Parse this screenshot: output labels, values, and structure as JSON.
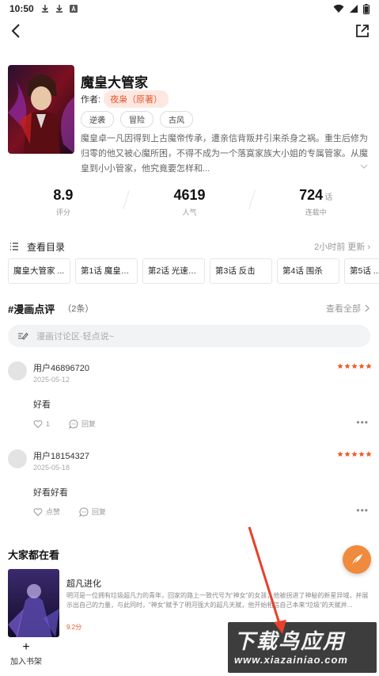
{
  "status_bar": {
    "time": "10:50"
  },
  "book": {
    "title": "魔皇大管家",
    "author_label": "作者:",
    "author": "夜枭（原著）",
    "tags": [
      "逆袭",
      "冒险",
      "古风"
    ],
    "description": "魔皇卓一凡因得到上古魔帝传承，遭亲信背叛并引来杀身之祸。重生后修为归零的他又被心魔所困，不得不成为一个落寞家族大小姐的专属管家。从魔皇到小小管家，他究竟要怎样和..."
  },
  "stats": [
    {
      "value": "8.9",
      "unit": "",
      "label": "评分"
    },
    {
      "value": "4619",
      "unit": "",
      "label": "人气"
    },
    {
      "value": "724",
      "unit": "话",
      "label": "连载中"
    }
  ],
  "toc": {
    "label": "查看目录",
    "update": "2小时前 更新",
    "chapters": [
      "魔皇大管家 ...",
      "第1话 魔皇的...",
      "第2话 光速突...",
      "第3话 反击",
      "第4话 围杀",
      "第5话 ..."
    ]
  },
  "comments": {
    "title": "#漫画点评",
    "count": "（2条）",
    "view_all": "查看全部",
    "input_placeholder": "漫画讨论区·轻点说~",
    "items": [
      {
        "user": "用户46896720",
        "date": "2025-05-12",
        "body": "好看",
        "likes": "1",
        "reply": "回复"
      },
      {
        "user": "用户18154327",
        "date": "2025-05-18",
        "body": "好看好看",
        "likes": "点赞",
        "reply": "回复"
      }
    ],
    "star_color": "#f25a2a"
  },
  "watching": {
    "title": "大家都在看",
    "item": {
      "title": "超凡进化",
      "desc": "明河是一位拥有垃圾超凡力的青年，回家的路上一致代号为“神女”的女孩，他被拐进了神秘的新星异域，并展示出自己的力量，与此同时，“神女”赋予了明河强大的超凡天赋，他开始相信自己本来“垃圾”的天赋并...",
      "score": "9.2分"
    }
  },
  "bottom": {
    "add_shelf": "加入书架"
  },
  "watermark": {
    "line1": "下载鸟应用",
    "line2": "www.xiazainiao.com"
  },
  "colors": {
    "accent": "#e8542a",
    "fab": "#f08a3c"
  }
}
